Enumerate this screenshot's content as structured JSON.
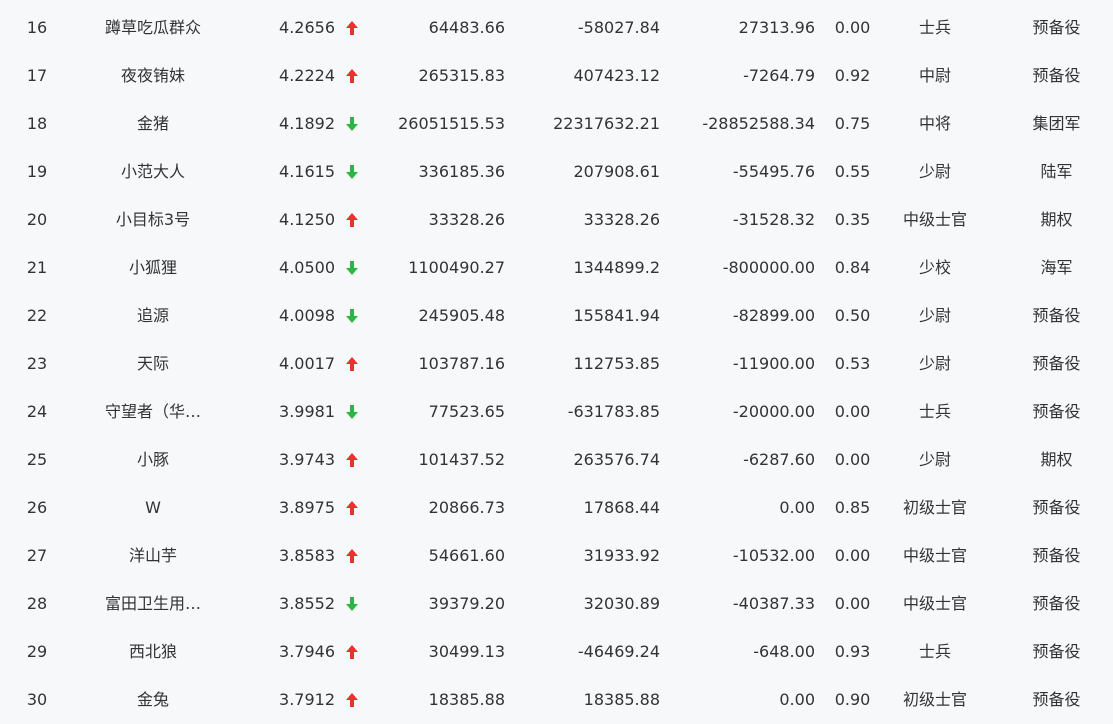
{
  "colors": {
    "up": "#e8322d",
    "down": "#2fb344",
    "text": "#333333",
    "background": "#f7f8fa"
  },
  "rows": [
    {
      "rank": "16",
      "name": "蹲草吃瓜群众",
      "score": "4.2656",
      "trend": "up",
      "asset": "64483.66",
      "profit": "-58027.84",
      "today": "27313.96",
      "ratio": "0.00",
      "rank_title": "士兵",
      "group": "预备役"
    },
    {
      "rank": "17",
      "name": "夜夜铕妹",
      "score": "4.2224",
      "trend": "up",
      "asset": "265315.83",
      "profit": "407423.12",
      "today": "-7264.79",
      "ratio": "0.92",
      "rank_title": "中尉",
      "group": "预备役"
    },
    {
      "rank": "18",
      "name": "金猪",
      "score": "4.1892",
      "trend": "down",
      "asset": "26051515.53",
      "profit": "22317632.21",
      "today": "-28852588.34",
      "ratio": "0.75",
      "rank_title": "中将",
      "group": "集团军"
    },
    {
      "rank": "19",
      "name": "小范大人",
      "score": "4.1615",
      "trend": "down",
      "asset": "336185.36",
      "profit": "207908.61",
      "today": "-55495.76",
      "ratio": "0.55",
      "rank_title": "少尉",
      "group": "陆军"
    },
    {
      "rank": "20",
      "name": "小目标3号",
      "score": "4.1250",
      "trend": "up",
      "asset": "33328.26",
      "profit": "33328.26",
      "today": "-31528.32",
      "ratio": "0.35",
      "rank_title": "中级士官",
      "group": "期权"
    },
    {
      "rank": "21",
      "name": "小狐狸",
      "score": "4.0500",
      "trend": "down",
      "asset": "1100490.27",
      "profit": "1344899.2",
      "today": "-800000.00",
      "ratio": "0.84",
      "rank_title": "少校",
      "group": "海军"
    },
    {
      "rank": "22",
      "name": "追源",
      "score": "4.0098",
      "trend": "down",
      "asset": "245905.48",
      "profit": "155841.94",
      "today": "-82899.00",
      "ratio": "0.50",
      "rank_title": "少尉",
      "group": "预备役"
    },
    {
      "rank": "23",
      "name": "天际",
      "score": "4.0017",
      "trend": "up",
      "asset": "103787.16",
      "profit": "112753.85",
      "today": "-11900.00",
      "ratio": "0.53",
      "rank_title": "少尉",
      "group": "预备役"
    },
    {
      "rank": "24",
      "name": "守望者（华…",
      "score": "3.9981",
      "trend": "down",
      "asset": "77523.65",
      "profit": "-631783.85",
      "today": "-20000.00",
      "ratio": "0.00",
      "rank_title": "士兵",
      "group": "预备役"
    },
    {
      "rank": "25",
      "name": "小豚",
      "score": "3.9743",
      "trend": "up",
      "asset": "101437.52",
      "profit": "263576.74",
      "today": "-6287.60",
      "ratio": "0.00",
      "rank_title": "少尉",
      "group": "期权"
    },
    {
      "rank": "26",
      "name": "W",
      "score": "3.8975",
      "trend": "up",
      "asset": "20866.73",
      "profit": "17868.44",
      "today": "0.00",
      "ratio": "0.85",
      "rank_title": "初级士官",
      "group": "预备役"
    },
    {
      "rank": "27",
      "name": "洋山芋",
      "score": "3.8583",
      "trend": "up",
      "asset": "54661.60",
      "profit": "31933.92",
      "today": "-10532.00",
      "ratio": "0.00",
      "rank_title": "中级士官",
      "group": "预备役"
    },
    {
      "rank": "28",
      "name": "富田卫生用…",
      "score": "3.8552",
      "trend": "down",
      "asset": "39379.20",
      "profit": "32030.89",
      "today": "-40387.33",
      "ratio": "0.00",
      "rank_title": "中级士官",
      "group": "预备役"
    },
    {
      "rank": "29",
      "name": "西北狼",
      "score": "3.7946",
      "trend": "up",
      "asset": "30499.13",
      "profit": "-46469.24",
      "today": "-648.00",
      "ratio": "0.93",
      "rank_title": "士兵",
      "group": "预备役"
    },
    {
      "rank": "30",
      "name": "金兔",
      "score": "3.7912",
      "trend": "up",
      "asset": "18385.88",
      "profit": "18385.88",
      "today": "0.00",
      "ratio": "0.90",
      "rank_title": "初级士官",
      "group": "预备役"
    }
  ]
}
